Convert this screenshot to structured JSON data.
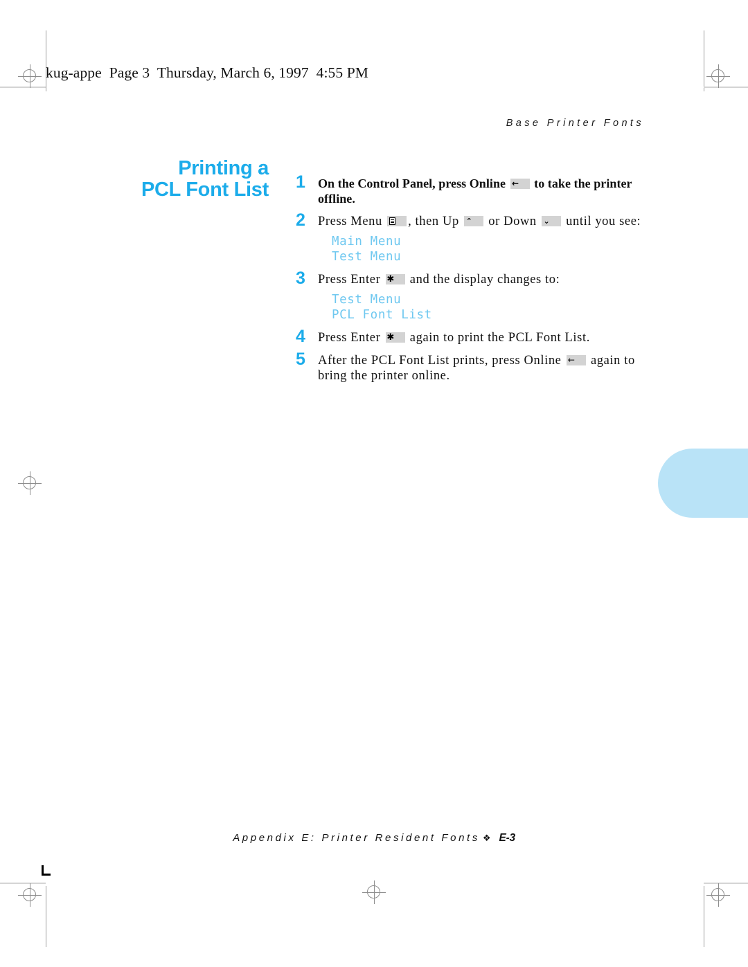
{
  "file_header": "kug-appe  Page 3  Thursday, March 6, 1997  4:55 PM",
  "running_head": "Base Printer Fonts",
  "section": {
    "title_line1": "Printing a",
    "title_line2": "PCL Font List",
    "title_color": "#1cacea"
  },
  "steps": [
    {
      "number": "1",
      "bold": true,
      "parts": [
        {
          "type": "text",
          "value": "On the Control Panel, press Online "
        },
        {
          "type": "key",
          "name": "online-key",
          "glyph": "←"
        },
        {
          "type": "text",
          "value": " to take the printer offline."
        }
      ]
    },
    {
      "number": "2",
      "bold": false,
      "parts": [
        {
          "type": "text",
          "value": "Press Menu "
        },
        {
          "type": "key",
          "name": "menu-key",
          "glyph": "menu"
        },
        {
          "type": "text",
          "value": ", then Up "
        },
        {
          "type": "key",
          "name": "up-key",
          "glyph": "⌃"
        },
        {
          "type": "text",
          "value": " or Down "
        },
        {
          "type": "key",
          "name": "down-key",
          "glyph": "⌄"
        },
        {
          "type": "text",
          "value": " until you see:"
        }
      ],
      "display": [
        "Main Menu",
        "Test Menu"
      ]
    },
    {
      "number": "3",
      "bold": false,
      "parts": [
        {
          "type": "text",
          "value": "Press Enter "
        },
        {
          "type": "key",
          "name": "enter-key",
          "glyph": "✱"
        },
        {
          "type": "text",
          "value": " and the display changes to:"
        }
      ],
      "display": [
        "Test Menu",
        "PCL Font List"
      ]
    },
    {
      "number": "4",
      "bold": false,
      "parts": [
        {
          "type": "text",
          "value": "Press Enter "
        },
        {
          "type": "key",
          "name": "enter-key",
          "glyph": "✱"
        },
        {
          "type": "text",
          "value": " again to print the PCL Font List."
        }
      ]
    },
    {
      "number": "5",
      "bold": false,
      "parts": [
        {
          "type": "text",
          "value": "After the PCL Font List prints, press Online "
        },
        {
          "type": "key",
          "name": "online-key",
          "glyph": "←"
        },
        {
          "type": "text",
          "value": " again to bring the printer online."
        }
      ]
    }
  ],
  "footer": {
    "text": "Appendix E: Printer Resident Fonts",
    "separator": "❖",
    "page_number": "E-3"
  },
  "decorations": {
    "bleed_tab_color": "#b9e3f7",
    "lcd_text_color": "#6fc8f0"
  }
}
